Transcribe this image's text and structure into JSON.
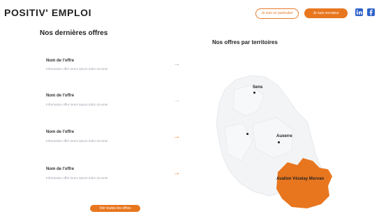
{
  "header": {
    "logo": "POSITIV' EMPLOI",
    "btn_ghost": "Je suis un particulier",
    "btn_fill": "Je suis recruteur"
  },
  "offers_section": {
    "title": "Nos dernières offres",
    "items": [
      {
        "title": "Nom de l'offre",
        "desc": "Information offre lorem ipsum dolor sit amet"
      },
      {
        "title": "Nom de l'offre",
        "desc": "Information offre lorem ipsum dolor sit amet"
      },
      {
        "title": "Nom de l'offre",
        "desc": "Information offre lorem ipsum dolor sit amet"
      },
      {
        "title": "Nom de l'offre",
        "desc": "Information offre lorem ipsum dolor sit amet"
      }
    ],
    "cta": "Voir toutes les offres"
  },
  "map_section": {
    "title": "Nos offres par territoires",
    "labels": [
      "Sens",
      "Auxerre",
      "Avallon Vézelay Morvan"
    ]
  },
  "colors": {
    "accent": "#e8761f",
    "social": "#2f62c9"
  },
  "icons": [
    "linkedin-icon",
    "facebook-icon",
    "arrow-right-icon"
  ]
}
